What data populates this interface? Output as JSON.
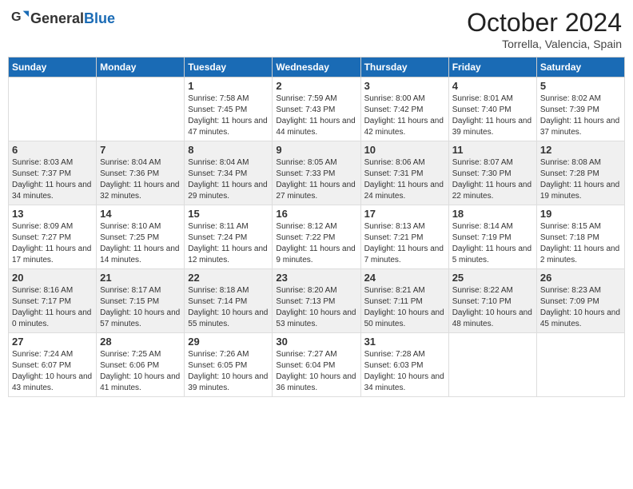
{
  "header": {
    "logo_general": "General",
    "logo_blue": "Blue",
    "month_title": "October 2024",
    "location": "Torrella, Valencia, Spain"
  },
  "days_of_week": [
    "Sunday",
    "Monday",
    "Tuesday",
    "Wednesday",
    "Thursday",
    "Friday",
    "Saturday"
  ],
  "weeks": [
    [
      {
        "day": "",
        "sunrise": "",
        "sunset": "",
        "daylight": ""
      },
      {
        "day": "",
        "sunrise": "",
        "sunset": "",
        "daylight": ""
      },
      {
        "day": "1",
        "sunrise": "Sunrise: 7:58 AM",
        "sunset": "Sunset: 7:45 PM",
        "daylight": "Daylight: 11 hours and 47 minutes."
      },
      {
        "day": "2",
        "sunrise": "Sunrise: 7:59 AM",
        "sunset": "Sunset: 7:43 PM",
        "daylight": "Daylight: 11 hours and 44 minutes."
      },
      {
        "day": "3",
        "sunrise": "Sunrise: 8:00 AM",
        "sunset": "Sunset: 7:42 PM",
        "daylight": "Daylight: 11 hours and 42 minutes."
      },
      {
        "day": "4",
        "sunrise": "Sunrise: 8:01 AM",
        "sunset": "Sunset: 7:40 PM",
        "daylight": "Daylight: 11 hours and 39 minutes."
      },
      {
        "day": "5",
        "sunrise": "Sunrise: 8:02 AM",
        "sunset": "Sunset: 7:39 PM",
        "daylight": "Daylight: 11 hours and 37 minutes."
      }
    ],
    [
      {
        "day": "6",
        "sunrise": "Sunrise: 8:03 AM",
        "sunset": "Sunset: 7:37 PM",
        "daylight": "Daylight: 11 hours and 34 minutes."
      },
      {
        "day": "7",
        "sunrise": "Sunrise: 8:04 AM",
        "sunset": "Sunset: 7:36 PM",
        "daylight": "Daylight: 11 hours and 32 minutes."
      },
      {
        "day": "8",
        "sunrise": "Sunrise: 8:04 AM",
        "sunset": "Sunset: 7:34 PM",
        "daylight": "Daylight: 11 hours and 29 minutes."
      },
      {
        "day": "9",
        "sunrise": "Sunrise: 8:05 AM",
        "sunset": "Sunset: 7:33 PM",
        "daylight": "Daylight: 11 hours and 27 minutes."
      },
      {
        "day": "10",
        "sunrise": "Sunrise: 8:06 AM",
        "sunset": "Sunset: 7:31 PM",
        "daylight": "Daylight: 11 hours and 24 minutes."
      },
      {
        "day": "11",
        "sunrise": "Sunrise: 8:07 AM",
        "sunset": "Sunset: 7:30 PM",
        "daylight": "Daylight: 11 hours and 22 minutes."
      },
      {
        "day": "12",
        "sunrise": "Sunrise: 8:08 AM",
        "sunset": "Sunset: 7:28 PM",
        "daylight": "Daylight: 11 hours and 19 minutes."
      }
    ],
    [
      {
        "day": "13",
        "sunrise": "Sunrise: 8:09 AM",
        "sunset": "Sunset: 7:27 PM",
        "daylight": "Daylight: 11 hours and 17 minutes."
      },
      {
        "day": "14",
        "sunrise": "Sunrise: 8:10 AM",
        "sunset": "Sunset: 7:25 PM",
        "daylight": "Daylight: 11 hours and 14 minutes."
      },
      {
        "day": "15",
        "sunrise": "Sunrise: 8:11 AM",
        "sunset": "Sunset: 7:24 PM",
        "daylight": "Daylight: 11 hours and 12 minutes."
      },
      {
        "day": "16",
        "sunrise": "Sunrise: 8:12 AM",
        "sunset": "Sunset: 7:22 PM",
        "daylight": "Daylight: 11 hours and 9 minutes."
      },
      {
        "day": "17",
        "sunrise": "Sunrise: 8:13 AM",
        "sunset": "Sunset: 7:21 PM",
        "daylight": "Daylight: 11 hours and 7 minutes."
      },
      {
        "day": "18",
        "sunrise": "Sunrise: 8:14 AM",
        "sunset": "Sunset: 7:19 PM",
        "daylight": "Daylight: 11 hours and 5 minutes."
      },
      {
        "day": "19",
        "sunrise": "Sunrise: 8:15 AM",
        "sunset": "Sunset: 7:18 PM",
        "daylight": "Daylight: 11 hours and 2 minutes."
      }
    ],
    [
      {
        "day": "20",
        "sunrise": "Sunrise: 8:16 AM",
        "sunset": "Sunset: 7:17 PM",
        "daylight": "Daylight: 11 hours and 0 minutes."
      },
      {
        "day": "21",
        "sunrise": "Sunrise: 8:17 AM",
        "sunset": "Sunset: 7:15 PM",
        "daylight": "Daylight: 10 hours and 57 minutes."
      },
      {
        "day": "22",
        "sunrise": "Sunrise: 8:18 AM",
        "sunset": "Sunset: 7:14 PM",
        "daylight": "Daylight: 10 hours and 55 minutes."
      },
      {
        "day": "23",
        "sunrise": "Sunrise: 8:20 AM",
        "sunset": "Sunset: 7:13 PM",
        "daylight": "Daylight: 10 hours and 53 minutes."
      },
      {
        "day": "24",
        "sunrise": "Sunrise: 8:21 AM",
        "sunset": "Sunset: 7:11 PM",
        "daylight": "Daylight: 10 hours and 50 minutes."
      },
      {
        "day": "25",
        "sunrise": "Sunrise: 8:22 AM",
        "sunset": "Sunset: 7:10 PM",
        "daylight": "Daylight: 10 hours and 48 minutes."
      },
      {
        "day": "26",
        "sunrise": "Sunrise: 8:23 AM",
        "sunset": "Sunset: 7:09 PM",
        "daylight": "Daylight: 10 hours and 45 minutes."
      }
    ],
    [
      {
        "day": "27",
        "sunrise": "Sunrise: 7:24 AM",
        "sunset": "Sunset: 6:07 PM",
        "daylight": "Daylight: 10 hours and 43 minutes."
      },
      {
        "day": "28",
        "sunrise": "Sunrise: 7:25 AM",
        "sunset": "Sunset: 6:06 PM",
        "daylight": "Daylight: 10 hours and 41 minutes."
      },
      {
        "day": "29",
        "sunrise": "Sunrise: 7:26 AM",
        "sunset": "Sunset: 6:05 PM",
        "daylight": "Daylight: 10 hours and 39 minutes."
      },
      {
        "day": "30",
        "sunrise": "Sunrise: 7:27 AM",
        "sunset": "Sunset: 6:04 PM",
        "daylight": "Daylight: 10 hours and 36 minutes."
      },
      {
        "day": "31",
        "sunrise": "Sunrise: 7:28 AM",
        "sunset": "Sunset: 6:03 PM",
        "daylight": "Daylight: 10 hours and 34 minutes."
      },
      {
        "day": "",
        "sunrise": "",
        "sunset": "",
        "daylight": ""
      },
      {
        "day": "",
        "sunrise": "",
        "sunset": "",
        "daylight": ""
      }
    ]
  ]
}
